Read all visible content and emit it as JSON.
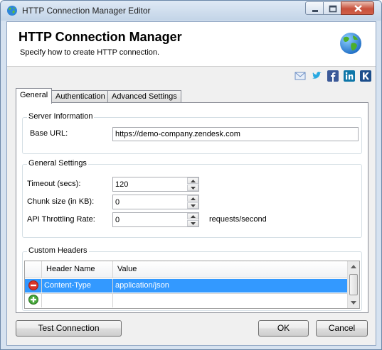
{
  "window": {
    "title": "HTTP Connection Manager Editor",
    "icon": "globe-icon"
  },
  "caption_buttons": {
    "minimize": "minimize-icon",
    "maximize": "maximize-icon",
    "close": "close-icon"
  },
  "header": {
    "title": "HTTP Connection Manager",
    "subtitle": "Specify how to create HTTP connection.",
    "icon": "globe-icon"
  },
  "social_links": [
    {
      "name": "email-icon",
      "color": "#6d8fc5"
    },
    {
      "name": "twitter-icon",
      "color": "#29a9e1"
    },
    {
      "name": "facebook-icon",
      "color": "#3b5998"
    },
    {
      "name": "linkedin-icon",
      "color": "#0e76a8"
    },
    {
      "name": "kingswaysoft-icon",
      "color": "#1d4f8c"
    }
  ],
  "tabs": [
    {
      "label": "General",
      "active": true
    },
    {
      "label": "Authentication",
      "active": false
    },
    {
      "label": "Advanced Settings",
      "active": false
    }
  ],
  "server_info": {
    "group_label": "Server Information",
    "base_url_label": "Base URL:",
    "base_url_value": "https://demo-company.zendesk.com"
  },
  "general_settings": {
    "group_label": "General Settings",
    "timeout_label": "Timeout (secs):",
    "timeout_value": "120",
    "chunk_label": "Chunk size (in KB):",
    "chunk_value": "0",
    "throttle_label": "API Throttling Rate:",
    "throttle_value": "0",
    "throttle_unit": "requests/second"
  },
  "custom_headers": {
    "group_label": "Custom Headers",
    "columns": [
      "Header Name",
      "Value"
    ],
    "rows": [
      {
        "name": "Content-Type",
        "value": "application/json",
        "selected": true,
        "icon": "remove-row-icon"
      },
      {
        "name": "",
        "value": "",
        "selected": false,
        "icon": "add-row-icon"
      }
    ]
  },
  "buttons": {
    "test_connection": "Test Connection",
    "ok": "OK",
    "cancel": "Cancel"
  },
  "colors": {
    "selection": "#3399ff",
    "remove": "#d9342b",
    "add": "#46a83a"
  }
}
